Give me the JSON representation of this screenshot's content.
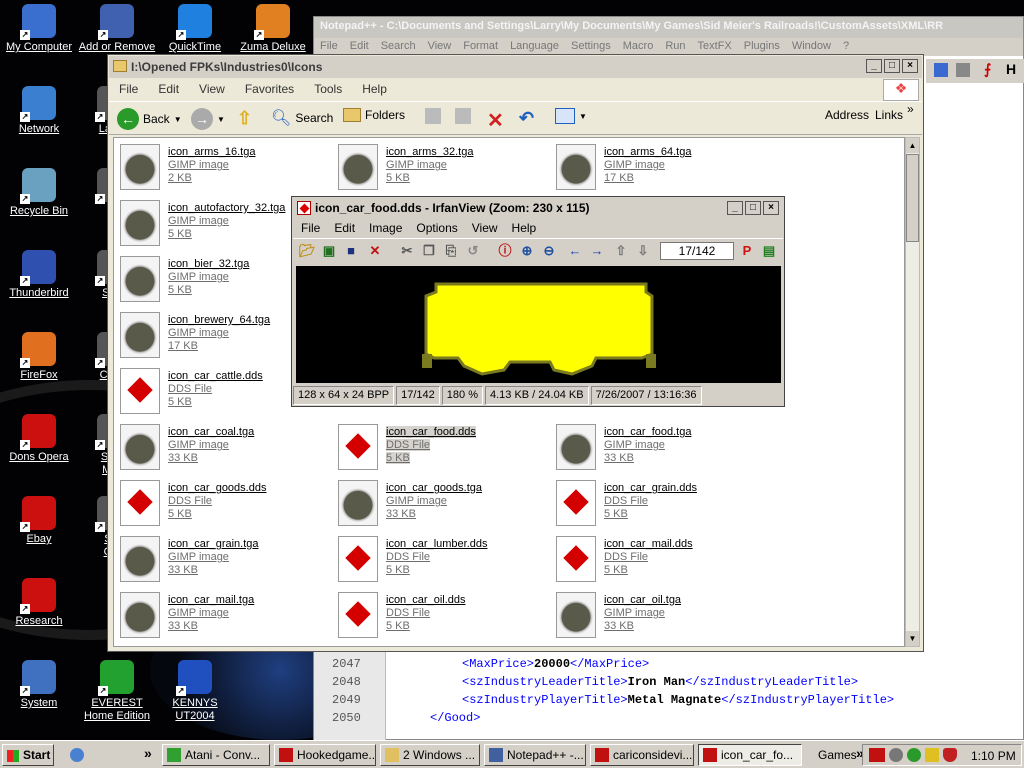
{
  "desktop": {
    "icons": [
      {
        "label": "My Computer",
        "icon": "computer-icon",
        "color": "#3a6fd0"
      },
      {
        "label": "Network",
        "icon": "network-icon",
        "color": "#3a7fd0"
      },
      {
        "label": "Recycle Bin",
        "icon": "recycle-bin-icon",
        "color": "#6aa0c0"
      },
      {
        "label": "Thunderbird",
        "icon": "thunderbird-icon",
        "color": "#3050b0"
      },
      {
        "label": "FireFox",
        "icon": "firefox-icon",
        "color": "#e07020"
      },
      {
        "label": "Dons Opera",
        "icon": "opera-icon",
        "color": "#cc1010"
      },
      {
        "label": "Ebay",
        "icon": "opera-icon",
        "color": "#cc1010"
      },
      {
        "label": "Research",
        "icon": "opera-icon",
        "color": "#cc1010"
      },
      {
        "label": "System",
        "icon": "system-icon",
        "color": "#4070c0"
      },
      {
        "label": "Add or Remove Pro",
        "icon": "add-remove-icon",
        "color": "#4060b0"
      },
      {
        "label": "QuickTime",
        "icon": "quicktime-icon",
        "color": "#2080e0"
      },
      {
        "label": "Zuma Deluxe",
        "icon": "zuma-icon",
        "color": "#e08020"
      },
      {
        "label": "La Me",
        "icon": "app-icon",
        "color": "#555"
      },
      {
        "label": "Se",
        "icon": "app-icon",
        "color": "#555"
      },
      {
        "label": "SMP",
        "icon": "app-icon",
        "color": "#555"
      },
      {
        "label": "Custo",
        "icon": "app-icon",
        "color": "#555"
      },
      {
        "label": "Short Meie",
        "icon": "app-icon",
        "color": "#555"
      },
      {
        "label": "Sho Ope",
        "icon": "app-icon",
        "color": "#555"
      },
      {
        "label": "EVEREST Home Edition",
        "icon": "everest-icon",
        "color": "#22a030"
      },
      {
        "label": "KENNYS UT2004",
        "icon": "ut2004-icon",
        "color": "#2050c0"
      }
    ]
  },
  "notepad": {
    "title": "Notepad++ - C:\\Documents and Settings\\Larry\\My Documents\\My Games\\Sid Meier's Railroads!\\CustomAssets\\XML\\RR",
    "menu": [
      "File",
      "Edit",
      "Search",
      "View",
      "Format",
      "Language",
      "Settings",
      "Macro",
      "Run",
      "TextFX",
      "Plugins",
      "Window",
      "?"
    ],
    "lines": [
      {
        "num": "2047",
        "open": "<MaxPrice>",
        "value": "20000",
        "close": "</MaxPrice>",
        "indent": "1"
      },
      {
        "num": "2048",
        "open": "<szIndustryLeaderTitle>",
        "value": "Iron Man",
        "close": "</szIndustryLeaderTitle>",
        "indent": "1"
      },
      {
        "num": "2049",
        "open": "<szIndustryPlayerTitle>",
        "value": "Metal Magnate",
        "close": "</szIndustryPlayerTitle>",
        "indent": "1"
      },
      {
        "num": "2050",
        "open": "</Good>",
        "value": "",
        "close": "",
        "indent": "0"
      }
    ]
  },
  "explorer": {
    "title": "I:\\Opened FPKs\\Industries0\\Icons",
    "menu": [
      "File",
      "Edit",
      "View",
      "Favorites",
      "Tools",
      "Help"
    ],
    "toolbar": {
      "back": "Back",
      "search": "Search",
      "folders": "Folders",
      "address": "Address",
      "links": "Links"
    },
    "files": [
      {
        "name": "icon_arms_16.tga",
        "type": "GIMP image",
        "size": "2 KB",
        "kind": "gimp"
      },
      {
        "name": "icon_arms_32.tga",
        "type": "GIMP image",
        "size": "5 KB",
        "kind": "gimp"
      },
      {
        "name": "icon_arms_64.tga",
        "type": "GIMP image",
        "size": "17 KB",
        "kind": "gimp"
      },
      {
        "name": "icon_autofactory_32.tga",
        "type": "GIMP image",
        "size": "5 KB",
        "kind": "gimp"
      },
      {
        "name": "icon_bier_32.tga",
        "type": "GIMP image",
        "size": "5 KB",
        "kind": "gimp"
      },
      {
        "name": "icon_brewery_64.tga",
        "type": "GIMP image",
        "size": "17 KB",
        "kind": "gimp"
      },
      {
        "name": "icon_car_cattle.dds",
        "type": "DDS File",
        "size": "5 KB",
        "kind": "dds"
      },
      {
        "name": "icon_car_coal.tga",
        "type": "GIMP image",
        "size": "33 KB",
        "kind": "gimp"
      },
      {
        "name": "icon_car_food.dds",
        "type": "DDS File",
        "size": "5 KB",
        "kind": "dds"
      },
      {
        "name": "icon_car_food.tga",
        "type": "GIMP image",
        "size": "33 KB",
        "kind": "gimp"
      },
      {
        "name": "icon_car_goods.dds",
        "type": "DDS File",
        "size": "5 KB",
        "kind": "dds"
      },
      {
        "name": "icon_car_goods.tga",
        "type": "GIMP image",
        "size": "33 KB",
        "kind": "gimp"
      },
      {
        "name": "icon_car_grain.dds",
        "type": "DDS File",
        "size": "5 KB",
        "kind": "dds"
      },
      {
        "name": "icon_car_grain.tga",
        "type": "GIMP image",
        "size": "33 KB",
        "kind": "gimp"
      },
      {
        "name": "icon_car_lumber.dds",
        "type": "DDS File",
        "size": "5 KB",
        "kind": "dds"
      },
      {
        "name": "icon_car_mail.dds",
        "type": "DDS File",
        "size": "5 KB",
        "kind": "dds"
      },
      {
        "name": "icon_car_mail.tga",
        "type": "GIMP image",
        "size": "33 KB",
        "kind": "gimp"
      },
      {
        "name": "icon_car_oil.dds",
        "type": "DDS File",
        "size": "5 KB",
        "kind": "dds"
      },
      {
        "name": "icon_car_oil.tga",
        "type": "GIMP image",
        "size": "33 KB",
        "kind": "gimp"
      }
    ]
  },
  "irfanview": {
    "title": "icon_car_food.dds - IrfanView (Zoom: 230 x 115)",
    "menu": [
      "File",
      "Edit",
      "Image",
      "Options",
      "View",
      "Help"
    ],
    "page": "17/142",
    "status": [
      "128 x 64 x 24 BPP",
      "17/142",
      "180 %",
      "4.13 KB / 24.04 KB",
      "7/26/2007 / 13:16:36"
    ],
    "image_fill": "#ffff00"
  },
  "taskbar": {
    "start": "Start",
    "items": [
      "Atani - Conv...",
      "Hookedgame...",
      "2 Windows ...",
      "Notepad++ -...",
      "cariconsidevi...",
      "icon_car_fo..."
    ],
    "games": "Games",
    "clock": "1:10 PM"
  }
}
